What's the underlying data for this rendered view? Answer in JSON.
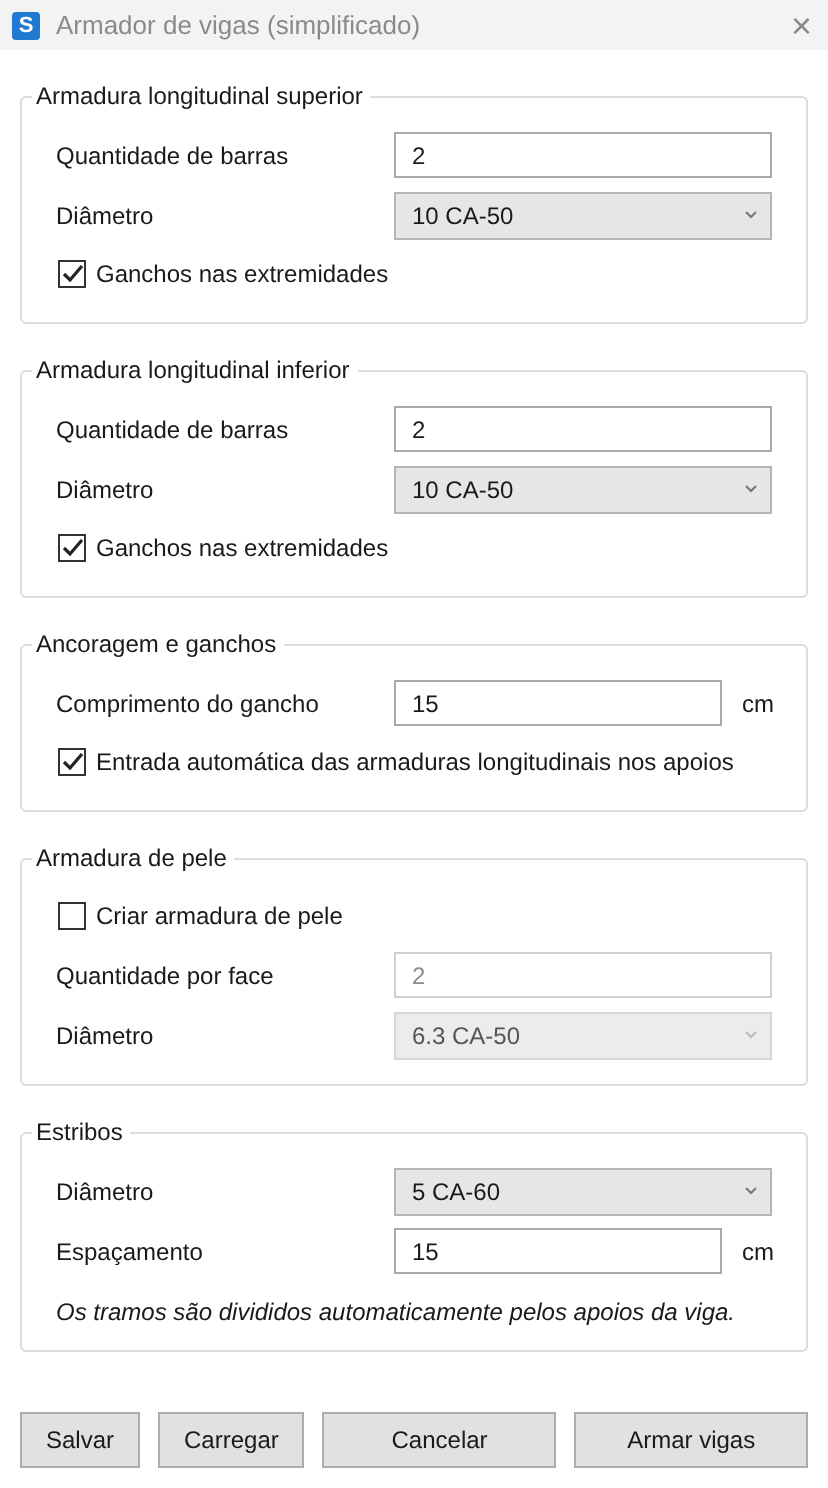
{
  "window": {
    "app_icon": "S",
    "title": "Armador de vigas (simplificado)",
    "close": "×"
  },
  "groups": [
    {
      "title": "Armadura longitudinal superior",
      "rows": [
        {
          "kind": "text",
          "label": "Quantidade de barras",
          "value": "2",
          "disabled": false
        },
        {
          "kind": "select",
          "label": "Diâmetro",
          "value": "10 CA-50",
          "disabled": false
        },
        {
          "kind": "checkbox",
          "label": "Ganchos nas extremidades",
          "checked": true
        }
      ]
    },
    {
      "title": "Armadura longitudinal inferior",
      "rows": [
        {
          "kind": "text",
          "label": "Quantidade de barras",
          "value": "2",
          "disabled": false
        },
        {
          "kind": "select",
          "label": "Diâmetro",
          "value": "10 CA-50",
          "disabled": false
        },
        {
          "kind": "checkbox",
          "label": "Ganchos nas extremidades",
          "checked": true
        }
      ]
    },
    {
      "title": "Ancoragem e ganchos",
      "rows": [
        {
          "kind": "text",
          "label": "Comprimento do gancho",
          "value": "15",
          "unit": "cm",
          "disabled": false
        },
        {
          "kind": "checkbox",
          "label": "Entrada automática das armaduras longitudinais nos apoios",
          "checked": true
        }
      ]
    },
    {
      "title": "Armadura de pele",
      "rows": [
        {
          "kind": "checkbox",
          "label": "Criar armadura de pele",
          "checked": false
        },
        {
          "kind": "text",
          "label": "Quantidade por face",
          "value": "2",
          "disabled": true
        },
        {
          "kind": "select",
          "label": "Diâmetro",
          "value": "6.3 CA-50",
          "disabled": true
        }
      ]
    },
    {
      "title": "Estribos",
      "rows": [
        {
          "kind": "select",
          "label": "Diâmetro",
          "value": "5 CA-60",
          "disabled": false
        },
        {
          "kind": "text",
          "label": "Espaçamento",
          "value": "15",
          "unit": "cm",
          "disabled": false
        },
        {
          "kind": "note",
          "text": "Os tramos são divididos automaticamente pelos apoios da viga."
        }
      ]
    }
  ],
  "buttons": [
    {
      "label": "Salvar"
    },
    {
      "label": "Carregar"
    },
    {
      "label": "Cancelar"
    },
    {
      "label": "Armar vigas"
    }
  ]
}
